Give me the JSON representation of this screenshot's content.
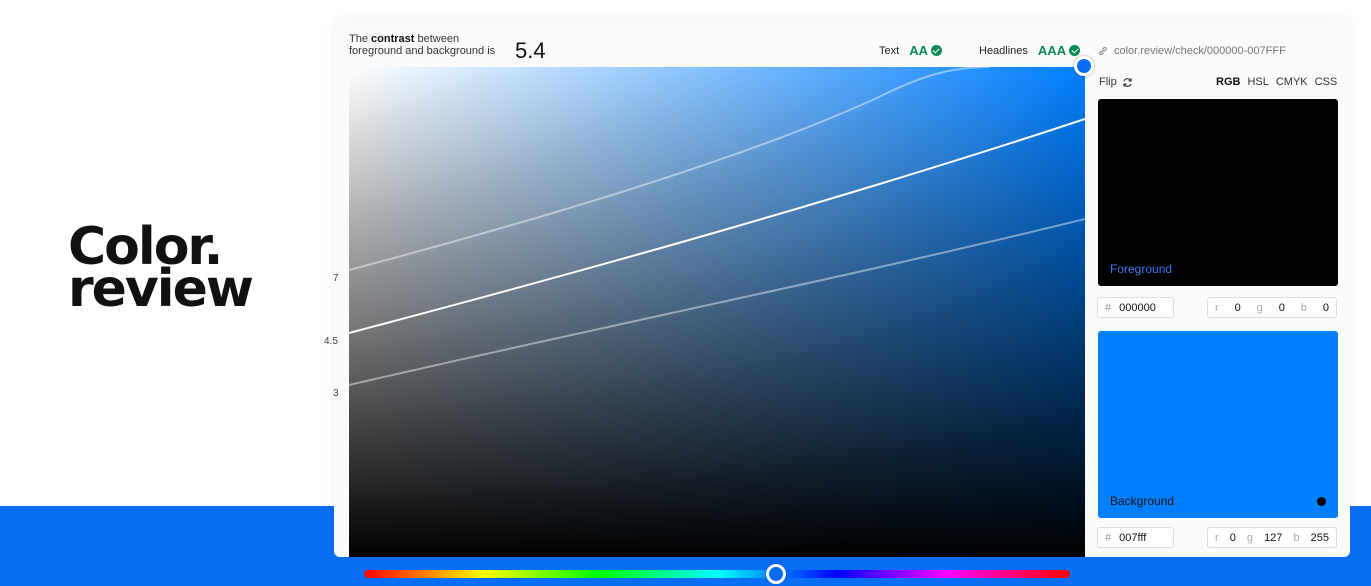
{
  "logo": {
    "line1": "Color.",
    "line2": "review"
  },
  "summary": {
    "prefix": "The",
    "contrast_word": "contrast",
    "suffix_line1": "between",
    "line2": "foreground and background is",
    "value": "5.4"
  },
  "badges": {
    "text_label": "Text",
    "text_level": "AA",
    "headlines_label": "Headlines",
    "headlines_level": "AAA"
  },
  "link": {
    "url": "color.review/check/000000-007FFF"
  },
  "plot": {
    "y_ticks": [
      "7",
      "4.5",
      "3"
    ]
  },
  "sidebar": {
    "flip_label": "Flip",
    "modes": [
      "RGB",
      "HSL",
      "CMYK",
      "CSS"
    ],
    "active_mode": "RGB",
    "foreground": {
      "label": "Foreground",
      "hex": "000000",
      "r": "0",
      "g": "0",
      "b": "0"
    },
    "background": {
      "label": "Background",
      "hex": "007fff",
      "r": "0",
      "g": "127",
      "b": "255"
    },
    "hash": "#",
    "r_key": "r",
    "g_key": "g",
    "b_key": "b"
  },
  "colors": {
    "accent": "#0a6ef5",
    "pass": "#0b8a55",
    "background_color": "#007fff",
    "foreground_color": "#000000"
  }
}
